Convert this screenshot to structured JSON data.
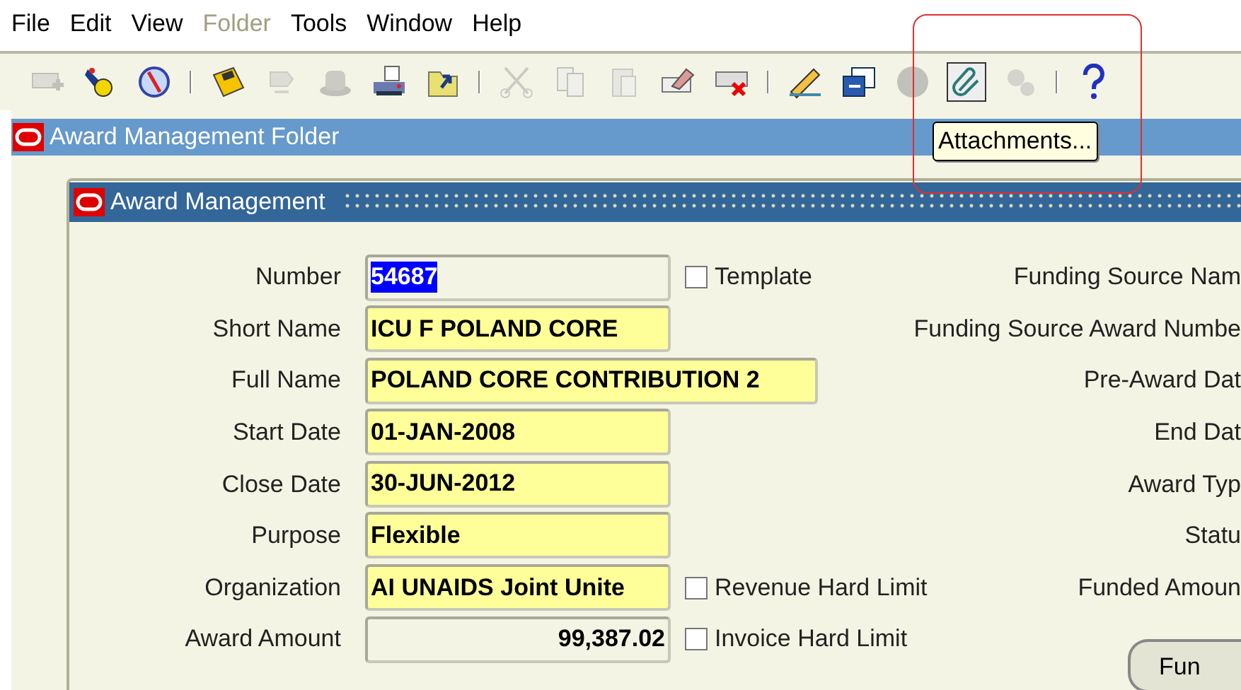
{
  "menu": [
    {
      "label": "File",
      "disabled": false
    },
    {
      "label": "Edit",
      "disabled": false
    },
    {
      "label": "View",
      "disabled": false
    },
    {
      "label": "Folder",
      "disabled": true
    },
    {
      "label": "Tools",
      "disabled": false
    },
    {
      "label": "Window",
      "disabled": false
    },
    {
      "label": "Help",
      "disabled": false
    }
  ],
  "toolbar": [
    {
      "kind": "new",
      "disabled": true,
      "pressed": false
    },
    {
      "kind": "find",
      "disabled": false,
      "pressed": false
    },
    {
      "kind": "navigator",
      "disabled": false,
      "pressed": false
    },
    {
      "kind": "separator"
    },
    {
      "kind": "save",
      "disabled": false,
      "pressed": false
    },
    {
      "kind": "next",
      "disabled": true,
      "pressed": false
    },
    {
      "kind": "switch",
      "disabled": true,
      "pressed": false
    },
    {
      "kind": "print",
      "disabled": false,
      "pressed": false
    },
    {
      "kind": "folder",
      "disabled": false,
      "pressed": false
    },
    {
      "kind": "separator"
    },
    {
      "kind": "cut",
      "disabled": true,
      "pressed": false
    },
    {
      "kind": "copy",
      "disabled": true,
      "pressed": false
    },
    {
      "kind": "paste",
      "disabled": true,
      "pressed": false
    },
    {
      "kind": "clear",
      "disabled": false,
      "pressed": false
    },
    {
      "kind": "delete",
      "disabled": false,
      "pressed": false
    },
    {
      "kind": "separator"
    },
    {
      "kind": "edit",
      "disabled": false,
      "pressed": false
    },
    {
      "kind": "zoom",
      "disabled": false,
      "pressed": false
    },
    {
      "kind": "globe",
      "disabled": true,
      "pressed": false
    },
    {
      "kind": "attach",
      "disabled": false,
      "pressed": true
    },
    {
      "kind": "tools",
      "disabled": true,
      "pressed": false
    },
    {
      "kind": "separator"
    },
    {
      "kind": "help",
      "disabled": false,
      "pressed": false
    }
  ],
  "tooltip": "Attachments...",
  "folder_window": {
    "title": "Award Management Folder"
  },
  "award_window": {
    "title": "Award Management"
  },
  "rows": [
    {
      "label": "Number",
      "field": {
        "value": "54687",
        "required": false,
        "selected": true,
        "wide": false,
        "kind": "text"
      },
      "checkbox": {
        "label": "Template",
        "checked": false
      },
      "right_label": "Funding Source Nam"
    },
    {
      "label": "Short Name",
      "field": {
        "value": "ICU F POLAND CORE",
        "required": true,
        "selected": false,
        "wide": false,
        "kind": "text"
      },
      "right_label": "Funding Source Award Numbe"
    },
    {
      "label": "Full Name",
      "field": {
        "value": "POLAND CORE CONTRIBUTION 2",
        "required": true,
        "selected": false,
        "wide": true,
        "kind": "text"
      },
      "right_label": "Pre-Award Dat"
    },
    {
      "label": "Start Date",
      "field": {
        "value": "01-JAN-2008",
        "required": true,
        "selected": false,
        "wide": false,
        "kind": "text"
      },
      "right_label": "End Dat"
    },
    {
      "label": "Close Date",
      "field": {
        "value": "30-JUN-2012",
        "required": true,
        "selected": false,
        "wide": false,
        "kind": "text"
      },
      "right_label": "Award Typ"
    },
    {
      "label": "Purpose",
      "field": {
        "value": "Flexible",
        "required": true,
        "selected": false,
        "wide": false,
        "kind": "text"
      },
      "right_label": "Statu"
    },
    {
      "label": "Organization",
      "field": {
        "value": "AI UNAIDS Joint Unite",
        "required": true,
        "selected": false,
        "wide": false,
        "kind": "text"
      },
      "checkbox": {
        "label": "Revenue Hard Limit",
        "checked": false
      },
      "right_label": "Funded Amoun"
    },
    {
      "label": "Award Amount",
      "field": {
        "value": "99,387.02",
        "required": false,
        "selected": false,
        "wide": false,
        "kind": "number"
      },
      "checkbox": {
        "label": "Invoice Hard Limit",
        "checked": false
      }
    }
  ],
  "button": "Fun"
}
